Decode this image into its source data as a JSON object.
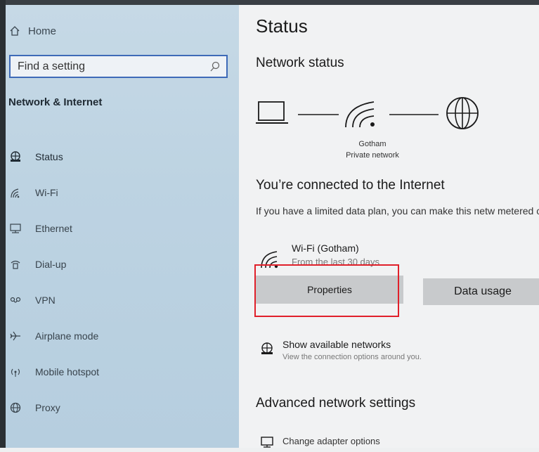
{
  "sidebar": {
    "home_label": "Home",
    "search_placeholder": "Find a setting",
    "section_title": "Network & Internet",
    "items": [
      {
        "label": "Status",
        "icon": "globe-status-icon"
      },
      {
        "label": "Wi-Fi",
        "icon": "wifi-icon"
      },
      {
        "label": "Ethernet",
        "icon": "ethernet-icon"
      },
      {
        "label": "Dial-up",
        "icon": "dialup-icon"
      },
      {
        "label": "VPN",
        "icon": "vpn-icon"
      },
      {
        "label": "Airplane mode",
        "icon": "airplane-icon"
      },
      {
        "label": "Mobile hotspot",
        "icon": "hotspot-icon"
      },
      {
        "label": "Proxy",
        "icon": "globe-icon"
      }
    ]
  },
  "main": {
    "title": "Status",
    "network_status_heading": "Network status",
    "network_name": "Gotham",
    "network_type": "Private network",
    "connected_heading": "You’re connected to the Internet",
    "description": "If you have a limited data plan, you can make this netw metered connection or change other properties.",
    "wifi_label": "Wi-Fi (Gotham)",
    "wifi_usage": "From the last 30 days",
    "properties_button": "Properties",
    "data_usage_button": "Data usage",
    "show_networks_title": "Show available networks",
    "show_networks_sub": "View the connection options around you.",
    "advanced_heading": "Advanced network settings",
    "change_adapter_label": "Change adapter options"
  },
  "colors": {
    "sidebar_bg": "#bdd3e2",
    "search_border": "#3e6ab8",
    "button_bg": "#c8cacc",
    "highlight": "#e0202a"
  }
}
